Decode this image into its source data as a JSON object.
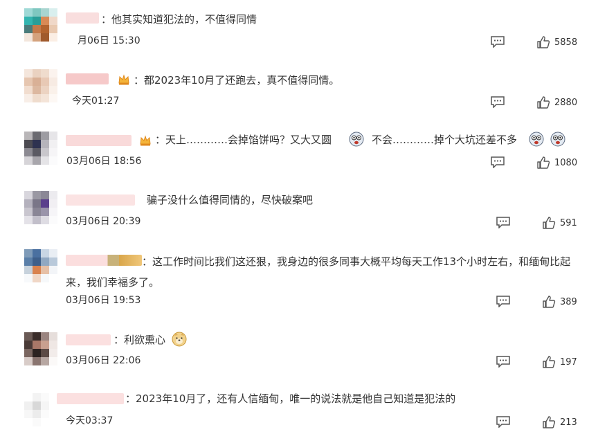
{
  "comments": [
    {
      "text": "：他其实知道犯法的，不值得同情",
      "time": "月06日 15:30",
      "likes": "5858"
    },
    {
      "text": "：都2023年10月了还跑去，真不值得同情。",
      "time": "今天01:27",
      "likes": "2880"
    },
    {
      "text_a": "：天上…………会掉馅饼吗？又大又圆",
      "text_b": "不会…………掉个大坑还差不多",
      "time": "03月06日 18:56",
      "likes": "1080"
    },
    {
      "text": "骗子没什么值得同情的，尽快破案吧",
      "time": "03月06日 20:39",
      "likes": "591"
    },
    {
      "text": "：这工作时间比我们这还狠，我身边的很多同事大概平均每天工作13个小时左右，和缅甸比起来，我们幸福多了。",
      "time": "03月06日 19:53",
      "likes": "389"
    },
    {
      "text": "：利欲熏心",
      "time": "03月06日 22:06",
      "likes": "197"
    },
    {
      "text": "：2023年10月了，还有人信缅甸，唯一的说法就是他自己知道是犯法的",
      "time": "今天03:37",
      "likes": "213"
    }
  ],
  "icons": {
    "reply": "comment-icon",
    "like": "thumb-up-icon",
    "crown": "crown-badge-icon",
    "emoji_dizzy": "dizzy-face-emoji",
    "emoji_doge": "doge-emoji"
  },
  "colors": {
    "text": "#333333",
    "icon": "#555555",
    "name_blur": "#f6d3d3"
  }
}
